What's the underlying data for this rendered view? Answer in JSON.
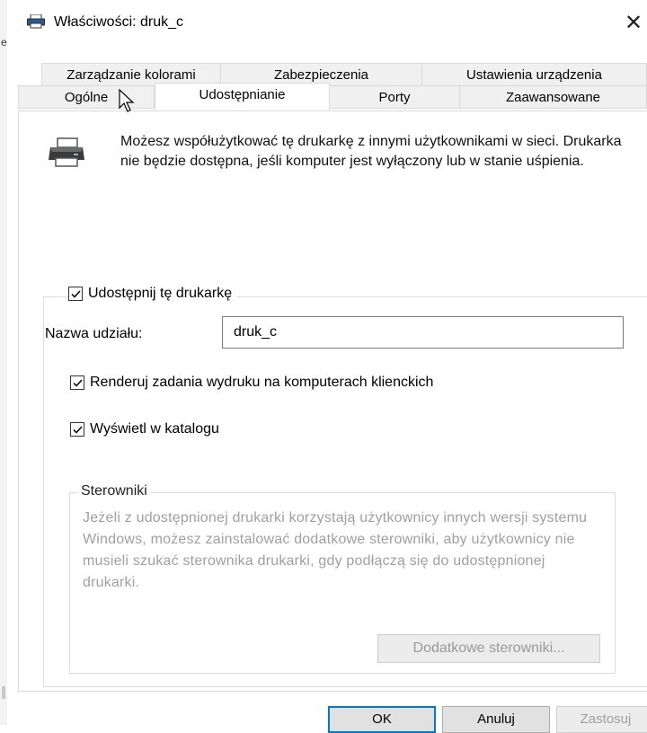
{
  "window": {
    "title": "Właściwości: druk_c",
    "close_glyph": "✕",
    "edge_char": "e"
  },
  "tabs": {
    "row1": [
      "Zarządzanie kolorami",
      "Zabezpieczenia",
      "Ustawienia urządzenia"
    ],
    "row2": [
      "Ogólne",
      "Udostępnianie",
      "Porty",
      "Zaawansowane"
    ],
    "active": "Udostępnianie"
  },
  "intro_text": "Możesz współużytkować tę drukarkę z innymi użytkownikami w sieci. Drukarka nie będzie dostępna, jeśli komputer jest wyłączony lub w stanie uśpienia.",
  "share": {
    "label": "Udostępnij tę drukarkę",
    "checked": true
  },
  "share_name": {
    "label": "Nazwa udziału:",
    "value": "druk_c"
  },
  "render_jobs": {
    "label": "Renderuj zadania wydruku na komputerach klienckich",
    "checked": true
  },
  "list_in_directory": {
    "label": "Wyświetl w katalogu",
    "checked": true
  },
  "drivers": {
    "legend": "Sterowniki",
    "text": "Jeżeli z udostępnionej drukarki korzystają użytkownicy innych wersji systemu Windows, możesz zainstalować dodatkowe sterowniki, aby użytkownicy nie musieli szukać sterownika drukarki, gdy podłączą się do udostępnionej drukarki.",
    "button": "Dodatkowe sterowniki..."
  },
  "buttons": {
    "ok": "OK",
    "cancel": "Anuluj",
    "apply": "Zastosuj"
  },
  "colors": {
    "focus_border": "#0078d7",
    "disabled_text": "#a0a0a0"
  }
}
